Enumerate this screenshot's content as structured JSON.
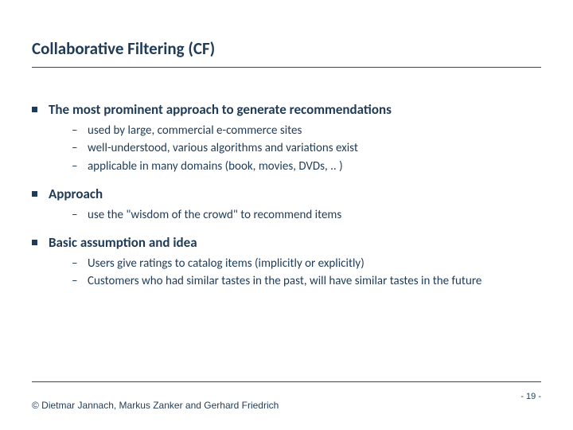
{
  "title": "Collaborative Filtering (CF)",
  "sections": [
    {
      "heading": "The most prominent approach to generate recommendations",
      "items": [
        "used by large, commercial e-commerce sites",
        "well-understood, various algorithms and variations exist",
        "applicable in many domains (book, movies, DVDs, .. )"
      ]
    },
    {
      "heading": "Approach",
      "items": [
        "use the \"wisdom of the crowd\" to recommend items"
      ]
    },
    {
      "heading": "Basic assumption and idea",
      "items": [
        "Users give ratings to catalog items (implicitly or explicitly)",
        "Customers who had similar tastes in the past, will have similar tastes in the future"
      ]
    }
  ],
  "footer": {
    "copyright": "© Dietmar Jannach, Markus Zanker and Gerhard Friedrich",
    "page": "- 19 -"
  }
}
